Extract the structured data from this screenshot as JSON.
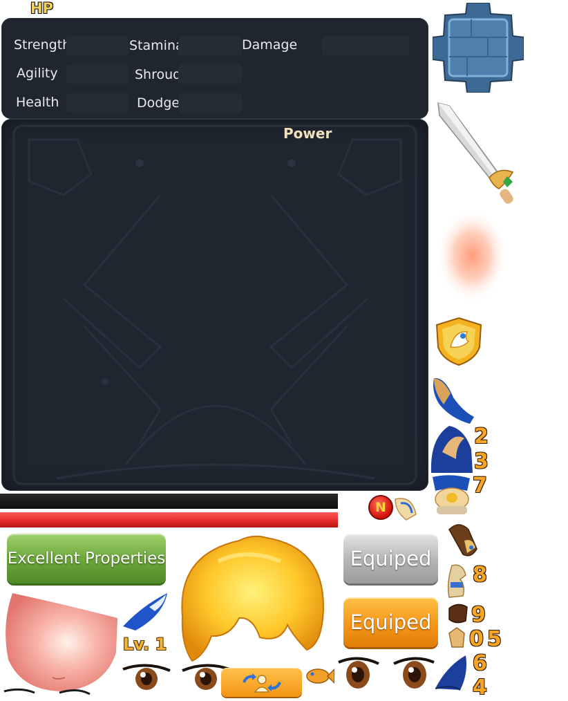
{
  "hud": {
    "hp_label": "HP"
  },
  "stats": {
    "strength": "Strength",
    "stamina": "Stamina",
    "damage": "Damage",
    "agility": "Agility",
    "shroud": "Shroud",
    "health": "Health",
    "dodge": "Dodge"
  },
  "panel": {
    "power_label": "Power"
  },
  "buttons": {
    "excellent_properties": "Excellent Properties",
    "equiped_gray": "Equiped",
    "equiped_orange": "Equiped"
  },
  "badges": {
    "new": "N",
    "level": "Lv. 1"
  },
  "digits": [
    "2",
    "3",
    "7",
    "8",
    "9",
    "0",
    "5",
    "6",
    "4"
  ],
  "icons": [
    "stone-frame-icon",
    "sword-icon",
    "glow-orb-icon",
    "shield-emblem-icon",
    "cape-piece-icon",
    "hat-piece-icon",
    "armor-icon",
    "hair-icon",
    "face-icon",
    "eye-icon",
    "feather-icon",
    "fish-icon",
    "swap-friends-icon"
  ],
  "colors": {
    "panel": "#1f262e",
    "hp_bar": "#e02828",
    "green_button": "#6aa43a",
    "orange_button": "#f59619",
    "gray_button": "#b4b4b4",
    "digit": "#f7a524"
  }
}
